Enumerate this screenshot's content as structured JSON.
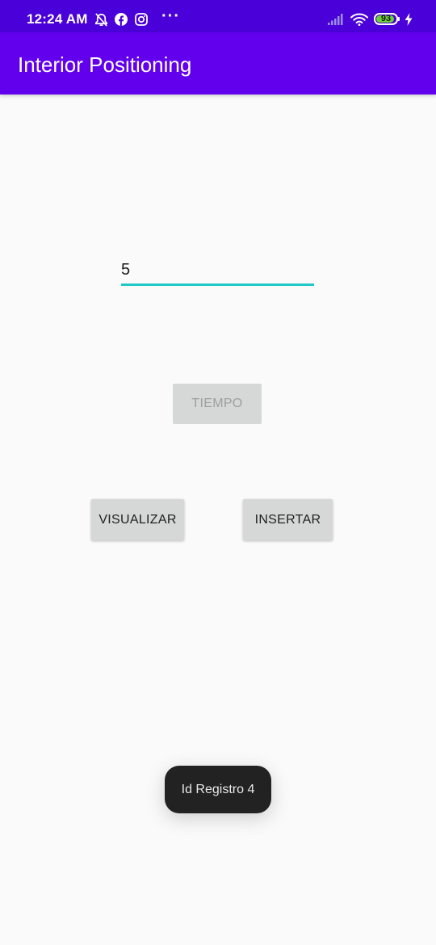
{
  "status_bar": {
    "time": "12:24 AM",
    "battery_level": "93",
    "battery_fraction": 0.93,
    "more_indicator": "···",
    "icons": [
      "alarm-off-icon",
      "facebook-icon",
      "instagram-icon",
      "more-icon",
      "signal-icon",
      "wifi-icon",
      "battery-icon",
      "charging-icon"
    ]
  },
  "app_bar": {
    "title": "Interior Positioning"
  },
  "form": {
    "input_value": "5"
  },
  "buttons": {
    "tiempo": "TIEMPO",
    "visualizar": "VISUALIZAR",
    "insertar": "INSERTAR"
  },
  "toast": {
    "message": "Id Registro 4"
  },
  "colors": {
    "status_bar": "#4a00d8",
    "app_bar": "#6200ee",
    "input_underline": "#22c7c7",
    "button": "#d6d7d7",
    "toast_bg": "#222222",
    "background": "#fafafa"
  }
}
